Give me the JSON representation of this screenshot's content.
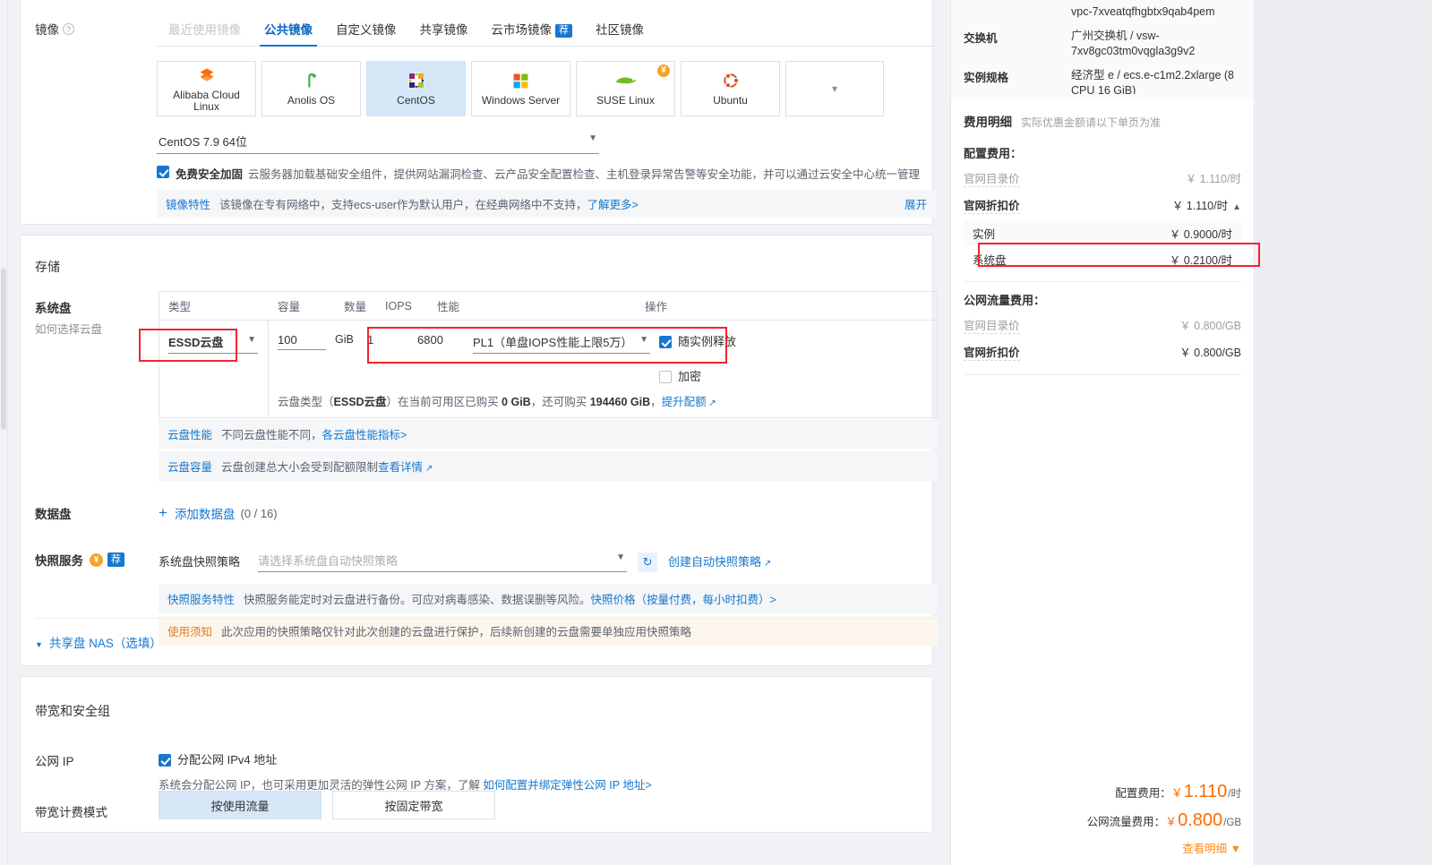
{
  "image_section": {
    "label": "镜像",
    "help_icon": "?",
    "tabs": [
      {
        "label": "最近使用镜像",
        "state": "disabled"
      },
      {
        "label": "公共镜像",
        "state": "active"
      },
      {
        "label": "自定义镜像",
        "state": "normal"
      },
      {
        "label": "共享镜像",
        "state": "normal"
      },
      {
        "label": "云市场镜像",
        "state": "normal",
        "badge": "荐"
      },
      {
        "label": "社区镜像",
        "state": "normal"
      }
    ],
    "os_cards": [
      {
        "name": "Alibaba Cloud Linux",
        "icon": "alibaba-cloud-linux-icon",
        "selected": false
      },
      {
        "name": "Anolis OS",
        "icon": "anolis-os-icon",
        "selected": false
      },
      {
        "name": "CentOS",
        "icon": "centos-icon",
        "selected": true
      },
      {
        "name": "Windows Server",
        "icon": "windows-icon",
        "selected": false
      },
      {
        "name": "SUSE Linux",
        "icon": "suse-linux-icon",
        "selected": false,
        "badge": "¥"
      },
      {
        "name": "Ubuntu",
        "icon": "ubuntu-icon",
        "selected": false
      },
      {
        "name": "",
        "icon": "chevron-down-icon",
        "selected": false
      }
    ],
    "version_select": "CentOS 7.9 64位",
    "security_checkbox": {
      "checked": true,
      "title": "免费安全加固",
      "description": "云服务器加载基础安全组件，提供网站漏洞检查、云产品安全配置检查、主机登录异常告警等安全功能，并可以通过云安全中心统一管理"
    },
    "note": {
      "tag": "镜像特性",
      "text": "该镜像在专有网络中，支持ecs-user作为默认用户，在经典网络中不支持，",
      "link": "了解更多>",
      "expand": "展开"
    }
  },
  "storage_section": {
    "title": "存储",
    "system_disk": {
      "label": "系统盘",
      "sub_label": "如何选择云盘",
      "columns": [
        "类型",
        "容量",
        "数量",
        "IOPS",
        "性能",
        "操作"
      ],
      "type": "ESSD云盘",
      "capacity": "100",
      "capacity_unit": "GiB",
      "count": "1",
      "iops": "6800",
      "performance": "PL1（单盘IOPS性能上限5万）",
      "release_with_instance": {
        "checked": true,
        "label": "随实例释放"
      },
      "encrypt": {
        "checked": false,
        "label": "加密"
      },
      "quota_note_1": "云盘类型（",
      "quota_type": "ESSD云盘",
      "quota_note_2": "）在当前可用区已购买 ",
      "quota_bought": "0 GiB",
      "quota_note_3": "，还可购买 ",
      "quota_remaining": "194460 GiB",
      "quota_note_4": "，",
      "quota_link": "提升配额"
    },
    "info_bars": [
      {
        "tag": "云盘性能",
        "text": "不同云盘性能不同，",
        "link": "各云盘性能指标>",
        "style": "info"
      },
      {
        "tag": "云盘容量",
        "text": "云盘创建总大小会受到配额限制 ",
        "link": "查看详情",
        "style": "info",
        "external": true
      }
    ],
    "data_disk": {
      "label": "数据盘",
      "add_label": "添加数据盘",
      "count": "(0 / 16)"
    },
    "snapshot": {
      "label": "快照服务",
      "yen_badge": "¥",
      "rec_badge": "荐",
      "sub_label": "系统盘快照策略",
      "placeholder": "请选择系统盘自动快照策略",
      "refresh_icon": "refresh-icon",
      "create_link": "创建自动快照策略",
      "feature_tag": "快照服务特性",
      "feature_text": "快照服务能定时对云盘进行备份。可应对病毒感染、数据误删等风险。",
      "feature_link": "快照价格（按量付费，每小时扣费）>",
      "warn_tag": "使用须知",
      "warn_text": "此次应用的快照策略仅针对此次创建的云盘进行保护，后续新创建的云盘需要单独应用快照策略"
    },
    "nas_link": "共享盘 NAS（选填）"
  },
  "bandwidth_section": {
    "title": "带宽和安全组",
    "public_ip_label": "公网 IP",
    "public_ip_checkbox": {
      "checked": true,
      "label": "分配公网 IPv4 地址"
    },
    "public_ip_desc": "系统会分配公网 IP，也可采用更加灵活的弹性公网 IP 方案，了解 ",
    "public_ip_link": "如何配置并绑定弹性公网 IP 地址>",
    "mode_label": "带宽计费模式",
    "modes": [
      {
        "label": "按使用流量",
        "selected": true
      },
      {
        "label": "按固定带宽",
        "selected": false
      }
    ]
  },
  "right_panel": {
    "spec_rows": [
      {
        "key": "",
        "value": "vpc-7xveatqfhgbtx9qab4pem"
      },
      {
        "key": "交换机",
        "value": "广州交换机 / vsw-7xv8gc03tm0vqgla3g9v2"
      },
      {
        "key": "实例规格",
        "value": "经济型 e / ecs.e-c1m2.2xlarge (8 CPU 16 GiB)"
      }
    ],
    "fee_title": "费用明细",
    "fee_note": "实际优惠金额请以下单页为准",
    "config_fee_title": "配置费用：",
    "config_list_price": {
      "label": "官网目录价",
      "value": "￥ 1.110",
      "unit": "/时"
    },
    "config_discount_price": {
      "label": "官网折扣价",
      "value": "￥ 1.110",
      "unit": "/时"
    },
    "config_breakdown": [
      {
        "label": "实例",
        "value": "￥ 0.9000",
        "unit": "/时"
      },
      {
        "label": "系统盘",
        "value": "￥ 0.2100",
        "unit": "/时"
      }
    ],
    "traffic_fee_title": "公网流量费用：",
    "traffic_list_price": {
      "label": "官网目录价",
      "value": "￥ 0.800",
      "unit": "/GB"
    },
    "traffic_discount_price": {
      "label": "官网折扣价",
      "value": "￥ 0.800",
      "unit": "/GB"
    },
    "total_config": {
      "label": "配置费用：",
      "currency": "￥",
      "amount": "1.110",
      "unit": "/时"
    },
    "total_traffic": {
      "label": "公网流量费用：",
      "currency": "￥",
      "amount": "0.800",
      "unit": "/GB"
    },
    "view_detail": "查看明细"
  },
  "colors": {
    "accent": "#1677cf",
    "highlight": "#f5222d",
    "orange": "#ff6a00",
    "selected_bg": "#d6e8f7"
  }
}
